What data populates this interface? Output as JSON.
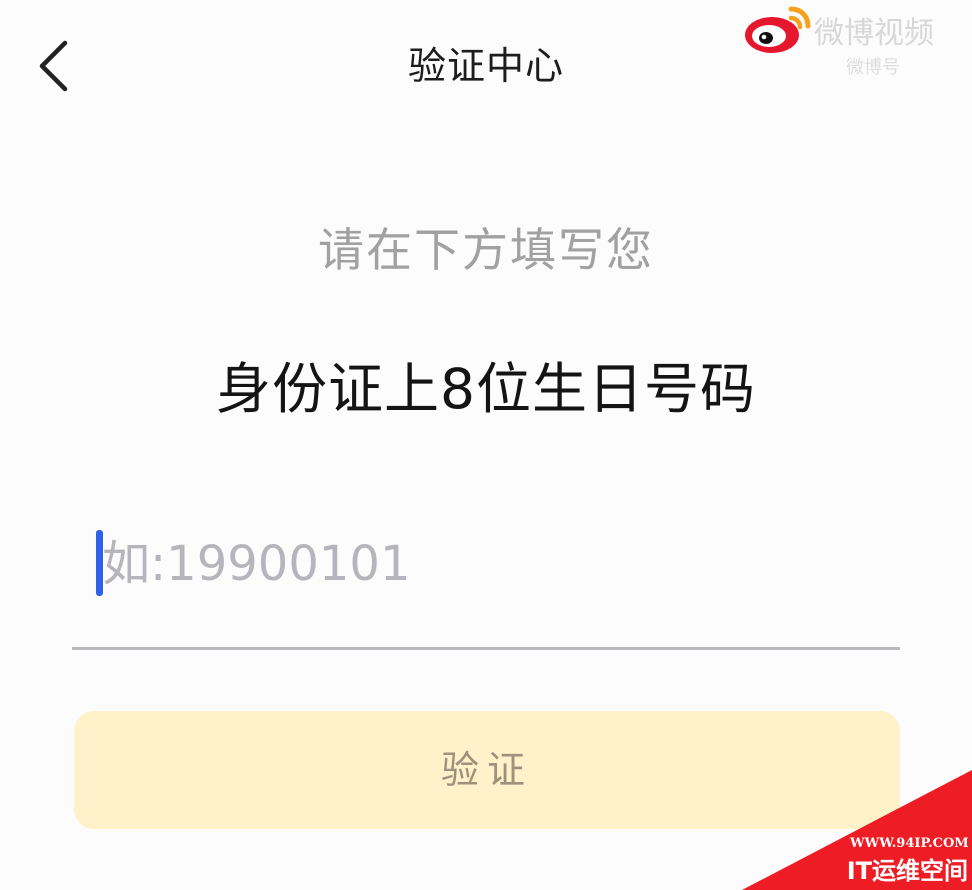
{
  "header": {
    "title": "验证中心",
    "back_icon": "chevron-left-icon"
  },
  "watermark": {
    "logo_icon": "weibo-logo-icon",
    "text": "微博视频",
    "subtext": "微博号"
  },
  "instruction": {
    "line1": "请在下方填写您",
    "line2": "身份证上8位生日号码"
  },
  "form": {
    "birthday_placeholder": "如:19900101",
    "birthday_value": "",
    "verify_label": "验证"
  },
  "corner_watermark": {
    "url": "WWW.94IP.COM",
    "brand": "IT运维空间"
  },
  "colors": {
    "background": "#fcfcfd",
    "title_text": "#1d1d1d",
    "secondary_text": "#a1a1a1",
    "primary_text": "#141414",
    "cursor": "#2f61e8",
    "button_background": "#fff1c9",
    "button_text": "#9e927d",
    "weibo_red": "#e6162d",
    "weibo_orange": "#f7a01b",
    "corner_red": "#ee1c25"
  }
}
